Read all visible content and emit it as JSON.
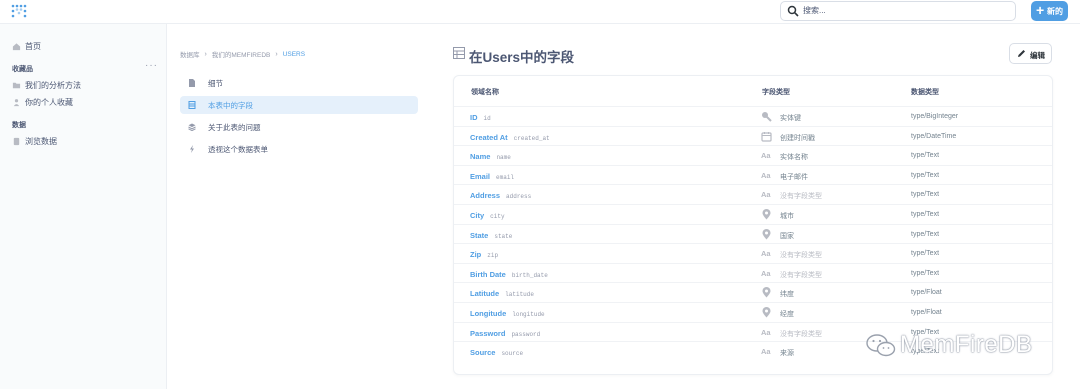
{
  "header": {
    "search_placeholder": "搜索...",
    "new_button": "新的"
  },
  "sidebar": {
    "home": "首页",
    "collections_heading": "收藏品",
    "collections_more": "···",
    "collections": [
      "我们的分析方法",
      "你的个人收藏"
    ],
    "data_heading": "数据",
    "browse": "浏览数据"
  },
  "breadcrumb": [
    "数据库",
    "我们的MEMFIREDB",
    "USERS"
  ],
  "nav": {
    "items": [
      "细节",
      "本表中的字段",
      "关于此表的问题",
      "透视这个数据表单"
    ]
  },
  "main": {
    "title": "在Users中的字段",
    "edit_button": "编辑",
    "columns": [
      "领域名称",
      "字段类型",
      "数据类型"
    ],
    "rows": [
      {
        "name": "ID",
        "db": "id",
        "icon": "key-icon",
        "semantic": "实体键",
        "type": "type/BigInteger",
        "muted": false
      },
      {
        "name": "Created At",
        "db": "created_at",
        "icon": "calendar-icon",
        "semantic": "创建时间戳",
        "type": "type/DateTime",
        "muted": false
      },
      {
        "name": "Name",
        "db": "name",
        "icon": "text-icon",
        "semantic": "实体名称",
        "type": "type/Text",
        "muted": false
      },
      {
        "name": "Email",
        "db": "email",
        "icon": "text-icon",
        "semantic": "电子邮件",
        "type": "type/Text",
        "muted": false
      },
      {
        "name": "Address",
        "db": "address",
        "icon": "text-icon",
        "semantic": "没有字段类型",
        "type": "type/Text",
        "muted": true
      },
      {
        "name": "City",
        "db": "city",
        "icon": "location-icon",
        "semantic": "城市",
        "type": "type/Text",
        "muted": false
      },
      {
        "name": "State",
        "db": "state",
        "icon": "location-icon",
        "semantic": "国家",
        "type": "type/Text",
        "muted": false
      },
      {
        "name": "Zip",
        "db": "zip",
        "icon": "text-icon",
        "semantic": "没有字段类型",
        "type": "type/Text",
        "muted": true
      },
      {
        "name": "Birth Date",
        "db": "birth_date",
        "icon": "text-icon",
        "semantic": "没有字段类型",
        "type": "type/Text",
        "muted": true
      },
      {
        "name": "Latitude",
        "db": "latitude",
        "icon": "location-icon",
        "semantic": "纬度",
        "type": "type/Float",
        "muted": false
      },
      {
        "name": "Longitude",
        "db": "longitude",
        "icon": "location-icon",
        "semantic": "经度",
        "type": "type/Float",
        "muted": false
      },
      {
        "name": "Password",
        "db": "password",
        "icon": "text-icon",
        "semantic": "没有字段类型",
        "type": "type/Text",
        "muted": true
      },
      {
        "name": "Source",
        "db": "source",
        "icon": "text-icon",
        "semantic": "来源",
        "type": "type/Text",
        "muted": false
      }
    ]
  },
  "watermark": "MemFireDB",
  "colors": {
    "accent": "#509ee3",
    "text": "#4c5773",
    "muted": "#949aab"
  }
}
